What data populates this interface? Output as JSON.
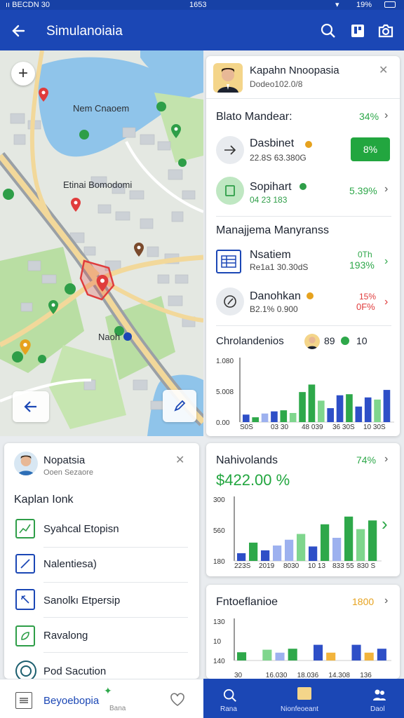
{
  "status": {
    "left": "ıı BECDN 30",
    "center": "1653",
    "right": "19%"
  },
  "appbar": {
    "title": "Simulanoiaia"
  },
  "map": {
    "labels": [
      "Nem Cnaoem",
      "Etinai Bomodomi",
      "Naoh"
    ],
    "zoom_in": "+"
  },
  "profile_card": {
    "name": "Kapahn Nnoopasia",
    "subtitle": "Dodeo102.0/8",
    "close": "✕"
  },
  "stats": {
    "section1_title": "Blato Mandear:",
    "section1_value": "34%",
    "section2_title": "Manajjema Manyranss",
    "items": [
      {
        "title": "Dasbinet",
        "sub": "22.8S 63.380G",
        "value": "8%"
      },
      {
        "title": "Sopihart",
        "sub": "04 23 183",
        "value": "5.39%"
      },
      {
        "title": "Nsatiem",
        "sub": "Re1a1 30.30dS",
        "value1": "0Th",
        "value2": "193%"
      },
      {
        "title": "Danohkan",
        "sub": "B2.1% 0.900",
        "value1": "15%",
        "value2": "0F%"
      }
    ]
  },
  "chart1": {
    "title": "Chrolandenios",
    "badge1": "89",
    "badge2": "10",
    "y_ticks": [
      "1.080",
      "5.008",
      "0.00"
    ],
    "x_ticks": [
      "S0S",
      "03 30",
      "48 039",
      "36 30S",
      "10 30S"
    ],
    "colors": {
      "blue": "#2e4fc7",
      "green": "#2ea84a",
      "lightgreen": "#7fd68d",
      "lightblue": "#9db1ef"
    }
  },
  "chart_data": [
    {
      "type": "bar",
      "title": "Chrolandenios",
      "ylim": [
        0,
        1.15
      ],
      "y_ticks": [
        "1.080",
        "5.008",
        "0.00"
      ],
      "x_ticks": [
        "S0S",
        "03 30",
        "48 039",
        "36 30S",
        "10 30S"
      ],
      "values": [
        0.14,
        0.09,
        0.16,
        0.2,
        0.22,
        0.17,
        0.56,
        0.7,
        0.4,
        0.26,
        0.5,
        0.52,
        0.29,
        0.46,
        0.42,
        0.6
      ],
      "colors": [
        "b",
        "g",
        "lb",
        "b",
        "g",
        "lg",
        "g",
        "g",
        "lg",
        "b",
        "b",
        "g",
        "b",
        "b",
        "lg",
        "b"
      ]
    },
    {
      "type": "bar",
      "title": "Nahivolands",
      "ylim": [
        0,
        320
      ],
      "y_ticks": [
        "300",
        "560",
        "180"
      ],
      "x_ticks": [
        "223S",
        "2019",
        "8030",
        "10 13",
        "833 55",
        "830 S"
      ],
      "values": [
        40,
        95,
        55,
        80,
        110,
        140,
        75,
        190,
        120,
        230,
        165,
        210
      ],
      "colors": [
        "b",
        "g",
        "b",
        "lb",
        "lb",
        "lg",
        "b",
        "g",
        "lb",
        "g",
        "lg",
        "g"
      ]
    },
    {
      "type": "bar",
      "title": "Fntoeflanioe",
      "ylim": [
        0,
        200
      ],
      "y_ticks": [
        "130",
        "10",
        "140"
      ],
      "x_ticks": [
        "30",
        "16.030",
        "18.036",
        "14.308",
        "136"
      ],
      "values": [
        42,
        0,
        55,
        40,
        60,
        0,
        80,
        40,
        0,
        80,
        40,
        60
      ],
      "colors": [
        "g",
        "lg",
        "lg",
        "lb",
        "g",
        "b",
        "b",
        "o",
        "b",
        "b",
        "o",
        "b"
      ]
    }
  ],
  "card_nahivolands": {
    "title": "Nahivolands",
    "pct": "74%",
    "amount": "$422.00 %",
    "y_ticks": [
      "300",
      "560",
      "180"
    ],
    "x_ticks": [
      "223S",
      "2019",
      "8030",
      "10 13",
      "833 55",
      "830 S"
    ]
  },
  "card_fntoeflanioe": {
    "title": "Fntoeflanioe",
    "value": "1800",
    "y_ticks": [
      "130",
      "10",
      "140"
    ],
    "x_ticks": [
      "30",
      "16.030",
      "18.036",
      "14.308",
      "136"
    ]
  },
  "left_card": {
    "name": "Nopatsia",
    "subtitle": "Ooen Sezaore",
    "close": "✕",
    "section": "Kaplan Ionk",
    "items": [
      "Syahcal Etopisn",
      "Nalentiesa)",
      "Sanolkı Etpersip",
      "Ravalong",
      "Pod Sacution"
    ]
  },
  "bottom_nav": {
    "left_label": "Beyoebopia",
    "left_sub": "Bana",
    "tabs": [
      "Rana",
      "Nionfeoeant",
      "Daol"
    ]
  }
}
